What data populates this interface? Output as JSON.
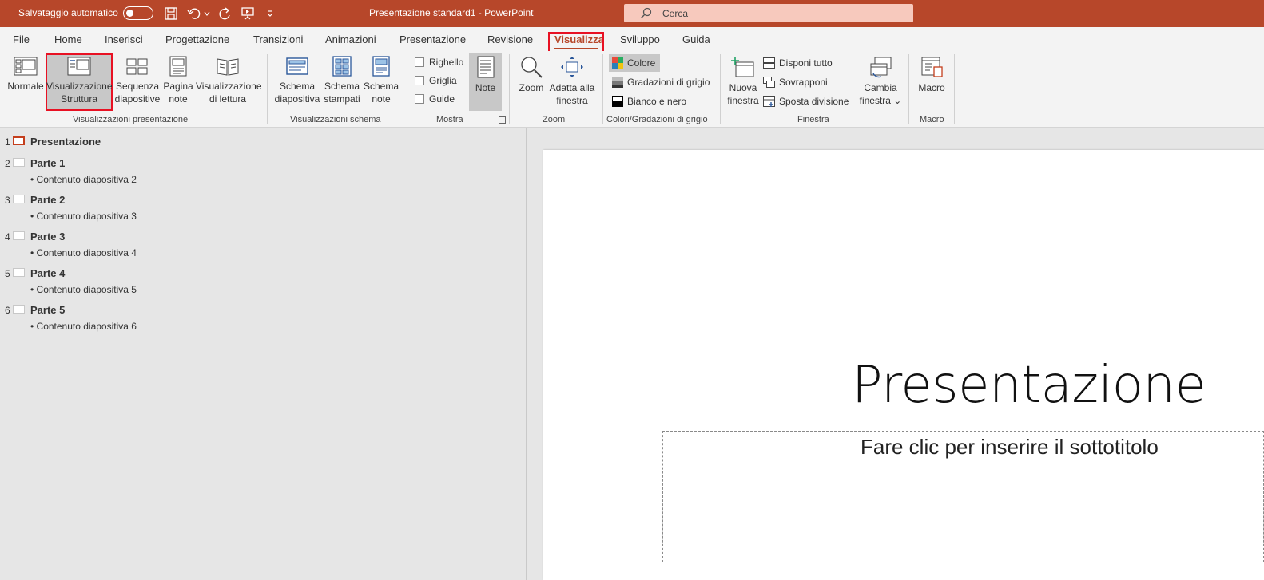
{
  "titlebar": {
    "autosave_label": "Salvataggio automatico",
    "title": "Presentazione standard1  -  PowerPoint",
    "search_placeholder": "Cerca"
  },
  "tabs": [
    "File",
    "Home",
    "Inserisci",
    "Progettazione",
    "Transizioni",
    "Animazioni",
    "Presentazione",
    "Revisione",
    "Visualizza",
    "Sviluppo",
    "Guida"
  ],
  "active_tab": "Visualizza",
  "ribbon": {
    "presentation_views": {
      "label": "Visualizzazioni presentazione",
      "normal": "Normale",
      "outline_1": "Visualizzazione",
      "outline_2": "Struttura",
      "sorter_1": "Sequenza",
      "sorter_2": "diapositive",
      "notes_page_1": "Pagina",
      "notes_page_2": "note",
      "reading_1": "Visualizzazione",
      "reading_2": "di lettura"
    },
    "master_views": {
      "label": "Visualizzazioni schema",
      "slide_master_1": "Schema",
      "slide_master_2": "diapositiva",
      "handout_master_1": "Schema",
      "handout_master_2": "stampati",
      "notes_master_1": "Schema",
      "notes_master_2": "note"
    },
    "show": {
      "label": "Mostra",
      "ruler": "Righello",
      "grid": "Griglia",
      "guides": "Guide",
      "notes": "Note"
    },
    "zoom": {
      "label": "Zoom",
      "zoom": "Zoom",
      "fit_1": "Adatta alla",
      "fit_2": "finestra"
    },
    "color": {
      "label": "Colori/Gradazioni di grigio",
      "color": "Colore",
      "grayscale": "Gradazioni di grigio",
      "bw": "Bianco e nero"
    },
    "window": {
      "label": "Finestra",
      "new_1": "Nuova",
      "new_2": "finestra",
      "arrange": "Disponi tutto",
      "cascade": "Sovrapponi",
      "split": "Sposta divisione",
      "switch_1": "Cambia",
      "switch_2": "finestra ⌄"
    },
    "macro": {
      "label": "Macro",
      "macro": "Macro"
    }
  },
  "outline": [
    {
      "num": "1",
      "title": "Presentazione",
      "content": ""
    },
    {
      "num": "2",
      "title": "Parte 1",
      "content": "• Contenuto diapositiva 2"
    },
    {
      "num": "3",
      "title": "Parte 2",
      "content": "• Contenuto diapositiva 3"
    },
    {
      "num": "4",
      "title": "Parte 3",
      "content": "• Contenuto diapositiva 4"
    },
    {
      "num": "5",
      "title": "Parte 4",
      "content": "• Contenuto diapositiva 5"
    },
    {
      "num": "6",
      "title": "Parte 5",
      "content": "• Contenuto diapositiva 6"
    }
  ],
  "slide": {
    "title": "Presentazione",
    "subtitle": "Fare clic per inserire il sottotitolo"
  },
  "colors": {
    "accent": "#b7472a",
    "highlight_border": "#e81123"
  }
}
